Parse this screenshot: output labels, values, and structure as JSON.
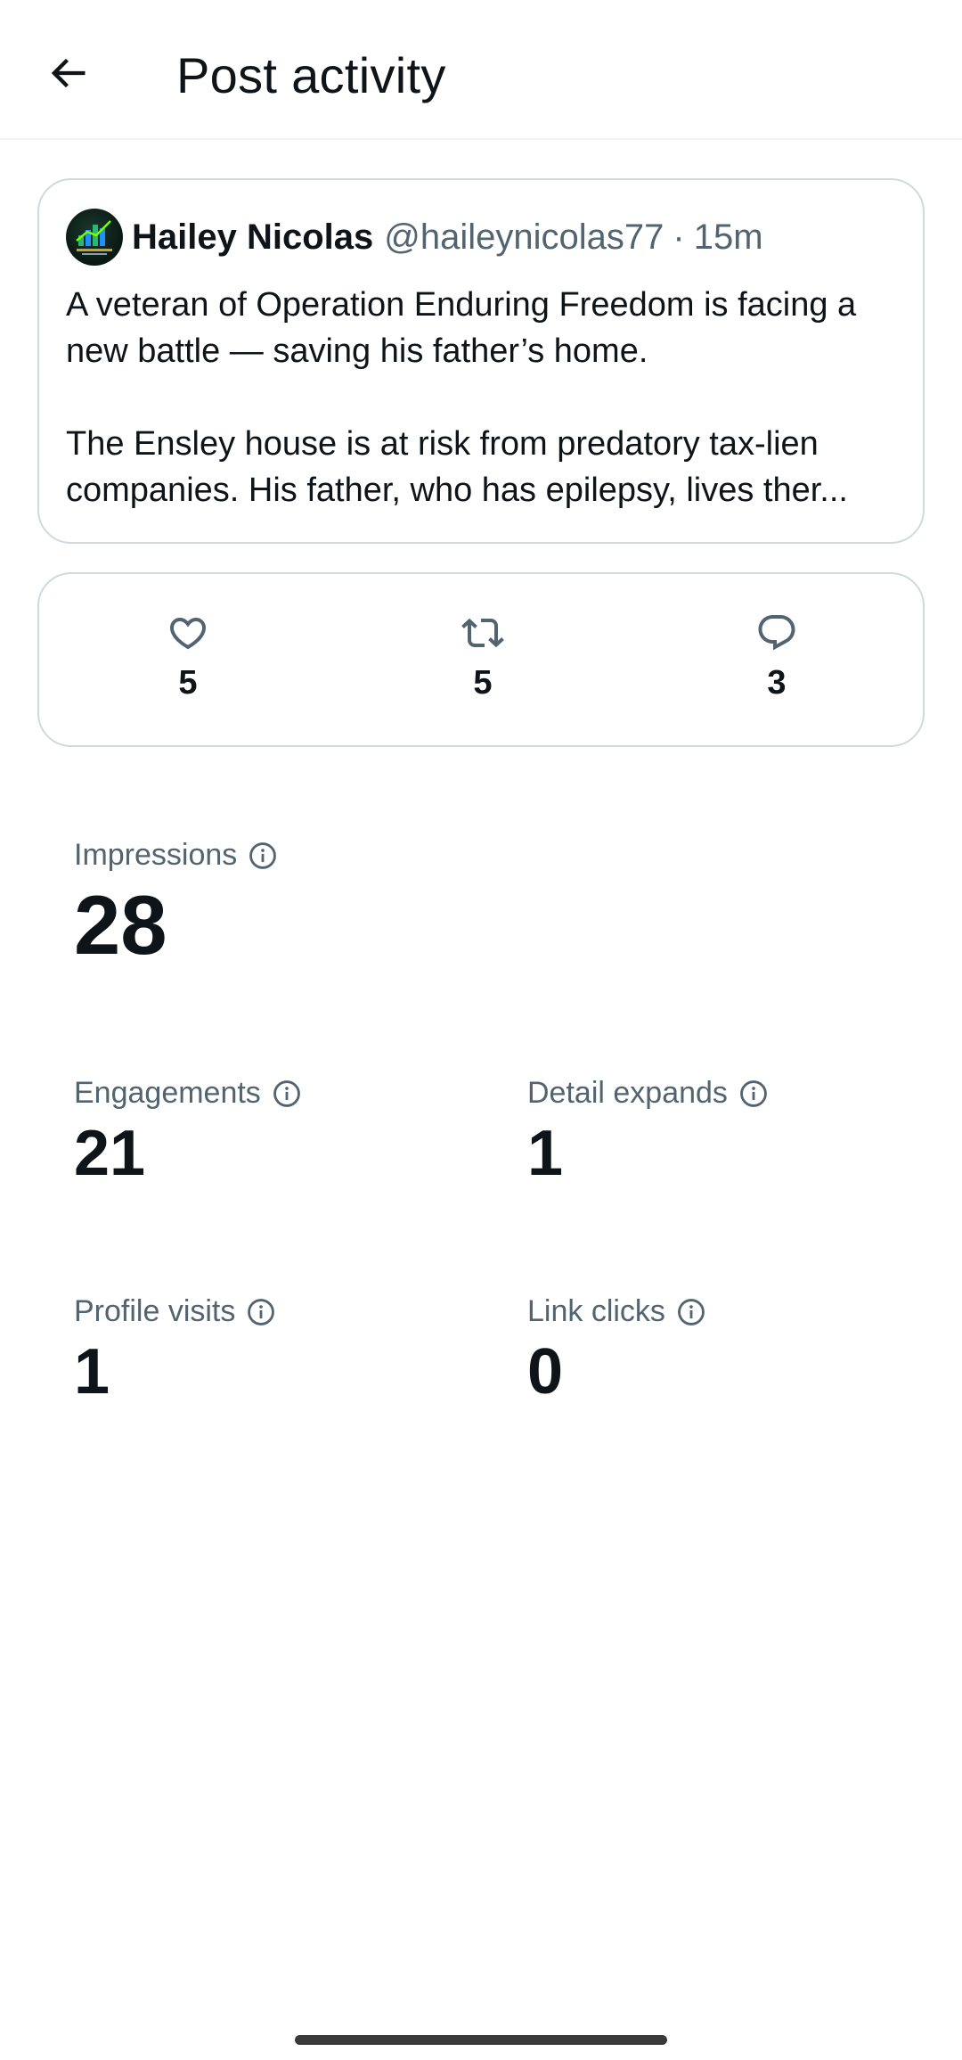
{
  "header": {
    "title": "Post activity",
    "back_icon": "arrow-left-icon"
  },
  "post": {
    "author_name": "Hailey Nicolas",
    "author_handle": "@haileynicolas77",
    "separator": "·",
    "time": "15m",
    "paragraph_1": "A veteran of Operation Enduring Freedom is facing a new battle — saving his father’s home.",
    "paragraph_2": "The Ensley house is at risk from predatory tax-lien companies. His father, who has epilepsy, lives ther..."
  },
  "engagement": {
    "likes": "5",
    "reposts": "5",
    "replies": "3"
  },
  "metrics": {
    "impressions": {
      "label": "Impressions",
      "value": "28"
    },
    "engagements": {
      "label": "Engagements",
      "value": "21"
    },
    "detail_expands": {
      "label": "Detail expands",
      "value": "1"
    },
    "profile_visits": {
      "label": "Profile visits",
      "value": "1"
    },
    "link_clicks": {
      "label": "Link clicks",
      "value": "0"
    }
  },
  "colors": {
    "text_primary": "#0f1419",
    "text_secondary": "#536471",
    "border": "#cfd9de"
  }
}
